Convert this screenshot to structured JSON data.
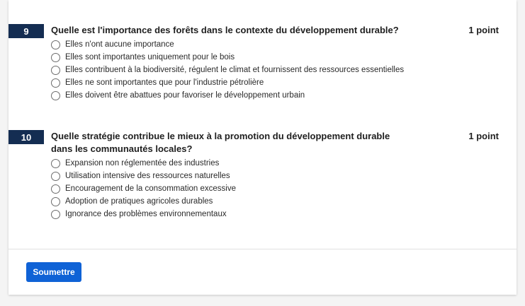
{
  "questions": [
    {
      "number": "9",
      "text": "Quelle est l'importance des forêts dans le contexte du développement durable?",
      "points": "1 point",
      "options": [
        "Elles n'ont aucune importance",
        "Elles sont importantes uniquement pour le bois",
        "Elles contribuent à la biodiversité, régulent le climat et fournissent des ressources essentielles",
        "Elles ne sont importantes que pour l'industrie pétrolière",
        "Elles doivent être abattues pour favoriser le développement urbain"
      ]
    },
    {
      "number": "10",
      "text": "Quelle stratégie contribue le mieux à la promotion du développement durable dans les communautés locales?",
      "points": "1 point",
      "options": [
        "Expansion non réglementée des industries",
        "Utilisation intensive des ressources naturelles",
        "Encouragement de la consommation excessive",
        "Adoption de pratiques agricoles durables",
        "Ignorance des problèmes environnementaux"
      ]
    }
  ],
  "submit_label": "Soumettre",
  "colors": {
    "number_badge": "#142d52",
    "submit_button": "#0f62d6"
  }
}
